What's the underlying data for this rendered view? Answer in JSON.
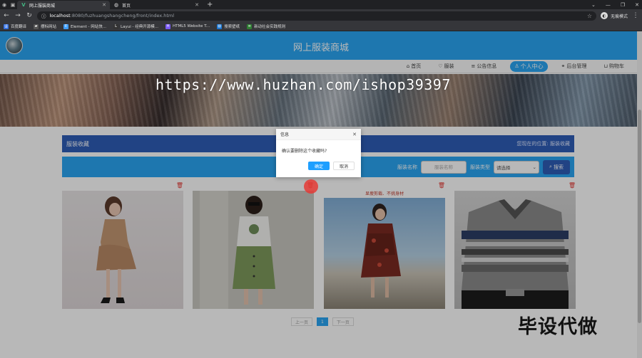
{
  "browser": {
    "tabs": [
      {
        "title": "网上服装商城",
        "active": true
      },
      {
        "title": "首页",
        "active": false
      }
    ],
    "url_host": "localhost",
    "url_path": ":8080/fuzhuangshangcheng/front/index.html",
    "profile_label": "无痕模式",
    "bookmarks": [
      "百度翻译",
      "摆标网站",
      "Element - 网站快...",
      "Layui - 经典开源模...",
      "HTML5 Website T...",
      "搜索壁纸",
      "新动社会实践规则"
    ]
  },
  "site": {
    "title": "网上服装商城",
    "nav": [
      {
        "label": "首页",
        "icon": "home-icon",
        "glyph": "⌂",
        "active": false
      },
      {
        "label": "服装",
        "icon": "shirt-icon",
        "glyph": "♡",
        "active": false
      },
      {
        "label": "公告信息",
        "icon": "list-icon",
        "glyph": "≡",
        "active": false
      },
      {
        "label": "个人中心",
        "icon": "user-icon",
        "glyph": "♙",
        "active": true
      },
      {
        "label": "后台管理",
        "icon": "link-icon",
        "glyph": "⚭",
        "active": false
      },
      {
        "label": "购物车",
        "icon": "cart-icon",
        "glyph": "⊔",
        "active": false
      }
    ],
    "watermark": "https://www.huzhan.com/ishop39397",
    "section_title": "服装收藏",
    "location_label": "您现在的位置:",
    "location_value": "服装收藏",
    "search": {
      "name_label": "服装名称",
      "name_placeholder": "服装名称",
      "type_label": "服装类型",
      "type_value": "请选择",
      "button_label": "搜索"
    },
    "cards": [
      {
        "art": "p1",
        "caption": ""
      },
      {
        "art": "p2",
        "caption": ""
      },
      {
        "art": "p3",
        "caption": "显瘦剪裁、不挑身材"
      },
      {
        "art": "p4",
        "caption": ""
      }
    ],
    "pager": {
      "prev": "上一页",
      "current": "1",
      "next": "下一页"
    },
    "dialog": {
      "title": "信息",
      "message": "确认要删除这个收藏吗?",
      "ok": "确定",
      "cancel": "取消"
    },
    "promo": "毕设代做"
  },
  "colors": {
    "header": "#2aa6f3",
    "breadcrumb": "#2e5db7",
    "delete": "#e53935",
    "dialog_ok": "#1e9fff"
  }
}
